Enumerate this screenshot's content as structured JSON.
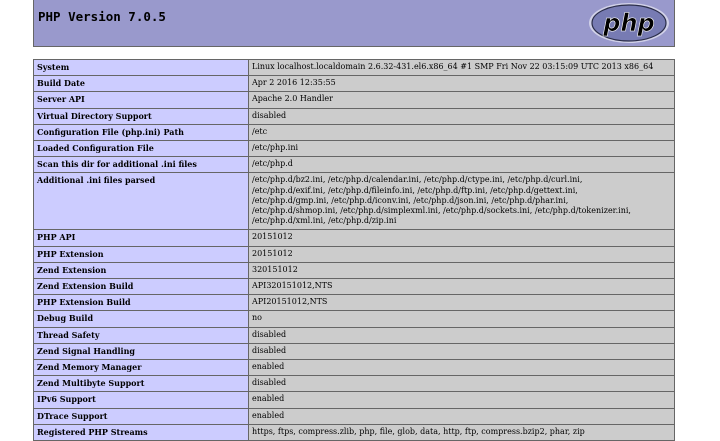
{
  "header": {
    "title": "PHP Version 7.0.5",
    "logo_text": "php",
    "colors": {
      "header_bg": "#9999cc",
      "label_bg": "#ccccff",
      "value_bg": "#cccccc",
      "logo": "#777bb3"
    }
  },
  "info_rows": [
    {
      "label": "System",
      "value": "Linux localhost.localdomain 2.6.32-431.el6.x86_64 #1 SMP Fri Nov 22 03:15:09 UTC 2013 x86_64"
    },
    {
      "label": "Build Date",
      "value": "Apr 2 2016 12:35:55"
    },
    {
      "label": "Server API",
      "value": "Apache 2.0 Handler"
    },
    {
      "label": "Virtual Directory Support",
      "value": "disabled"
    },
    {
      "label": "Configuration File (php.ini) Path",
      "value": "/etc"
    },
    {
      "label": "Loaded Configuration File",
      "value": "/etc/php.ini"
    },
    {
      "label": "Scan this dir for additional .ini files",
      "value": "/etc/php.d"
    },
    {
      "label": "Additional .ini files parsed",
      "lines": [
        "/etc/php.d/bz2.ini, /etc/php.d/calendar.ini, /etc/php.d/ctype.ini, /etc/php.d/curl.ini,",
        "/etc/php.d/exif.ini, /etc/php.d/fileinfo.ini, /etc/php.d/ftp.ini, /etc/php.d/gettext.ini,",
        "/etc/php.d/gmp.ini, /etc/php.d/iconv.ini, /etc/php.d/json.ini, /etc/php.d/phar.ini,",
        "/etc/php.d/shmop.ini, /etc/php.d/simplexml.ini, /etc/php.d/sockets.ini, /etc/php.d/tokenizer.ini,",
        "/etc/php.d/xml.ini, /etc/php.d/zip.ini"
      ]
    },
    {
      "label": "PHP API",
      "value": "20151012"
    },
    {
      "label": "PHP Extension",
      "value": "20151012"
    },
    {
      "label": "Zend Extension",
      "value": "320151012"
    },
    {
      "label": "Zend Extension Build",
      "value": "API320151012,NTS"
    },
    {
      "label": "PHP Extension Build",
      "value": "API20151012,NTS"
    },
    {
      "label": "Debug Build",
      "value": "no"
    },
    {
      "label": "Thread Safety",
      "value": "disabled"
    },
    {
      "label": "Zend Signal Handling",
      "value": "disabled"
    },
    {
      "label": "Zend Memory Manager",
      "value": "enabled"
    },
    {
      "label": "Zend Multibyte Support",
      "value": "disabled"
    },
    {
      "label": "IPv6 Support",
      "value": "enabled"
    },
    {
      "label": "DTrace Support",
      "value": "enabled"
    },
    {
      "label": "Registered PHP Streams",
      "value": "https, ftps, compress.zlib, php, file, glob, data, http, ftp, compress.bzip2, phar, zip"
    }
  ]
}
